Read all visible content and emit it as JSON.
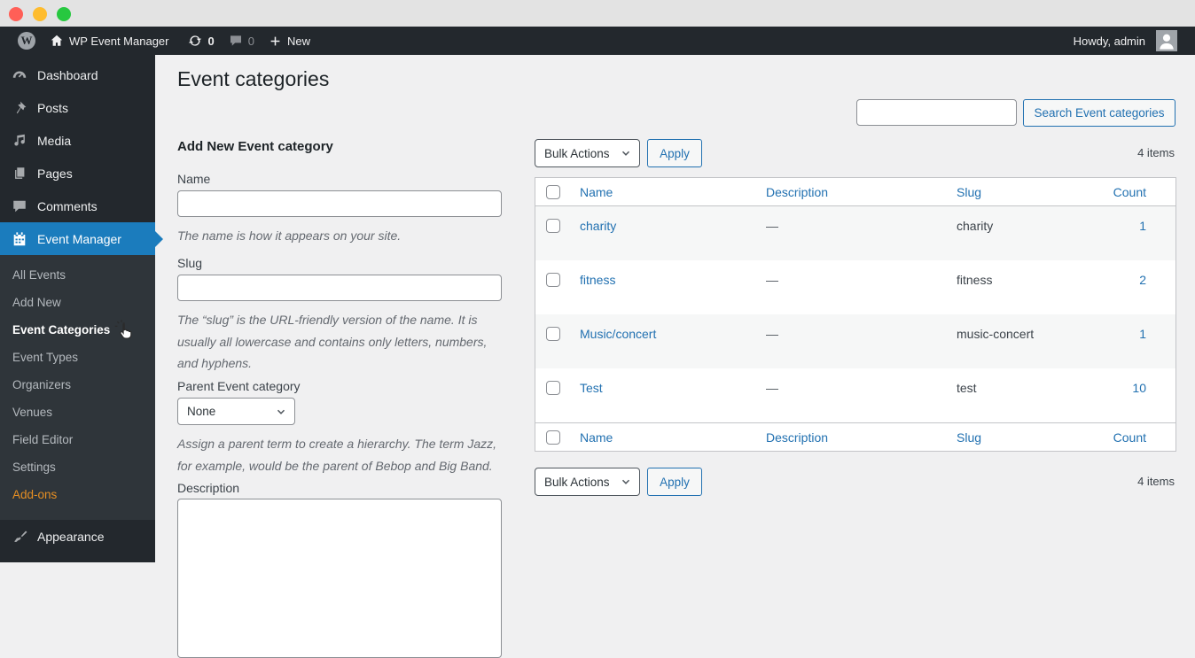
{
  "admin_bar": {
    "site_name": "WP Event Manager",
    "updates_count": "0",
    "comments_count": "0",
    "new_label": "New",
    "greeting": "Howdy, admin"
  },
  "sidebar": {
    "items": [
      {
        "label": "Dashboard"
      },
      {
        "label": "Posts"
      },
      {
        "label": "Media"
      },
      {
        "label": "Pages"
      },
      {
        "label": "Comments"
      },
      {
        "label": "Event Manager"
      },
      {
        "label": "Appearance"
      }
    ],
    "submenu": [
      {
        "label": "All Events"
      },
      {
        "label": "Add New"
      },
      {
        "label": "Event Categories"
      },
      {
        "label": "Event Types"
      },
      {
        "label": "Organizers"
      },
      {
        "label": "Venues"
      },
      {
        "label": "Field Editor"
      },
      {
        "label": "Settings"
      },
      {
        "label": "Add-ons"
      }
    ]
  },
  "page": {
    "title": "Event categories"
  },
  "form": {
    "heading": "Add New Event category",
    "name": {
      "label": "Name",
      "value": "",
      "help": "The name is how it appears on your site."
    },
    "slug": {
      "label": "Slug",
      "value": "",
      "help": "The “slug” is the URL-friendly version of the name. It is usually all lowercase and contains only letters, numbers, and hyphens."
    },
    "parent": {
      "label": "Parent Event category",
      "value": "None",
      "help": "Assign a parent term to create a hierarchy. The term Jazz, for example, would be the parent of Bebop and Big Band."
    },
    "description": {
      "label": "Description",
      "value": ""
    }
  },
  "list": {
    "search_value": "",
    "search_button": "Search Event categories",
    "bulk_actions": "Bulk Actions",
    "apply": "Apply",
    "items_count": "4 items",
    "columns": [
      "Name",
      "Description",
      "Slug",
      "Count"
    ],
    "rows": [
      {
        "name": "charity",
        "description": "—",
        "slug": "charity",
        "count": "1"
      },
      {
        "name": "fitness",
        "description": "—",
        "slug": "fitness",
        "count": "2"
      },
      {
        "name": "Music/concert",
        "description": "—",
        "slug": "music-concert",
        "count": "1"
      },
      {
        "name": "Test",
        "description": "—",
        "slug": "test",
        "count": "10"
      }
    ]
  },
  "colors": {
    "accent_blue": "#1b7cbd",
    "link_blue": "#2271b1",
    "addons_orange": "#e68f23",
    "adminbar_bg": "#23282d",
    "stripe_gray": "#f6f7f7"
  }
}
